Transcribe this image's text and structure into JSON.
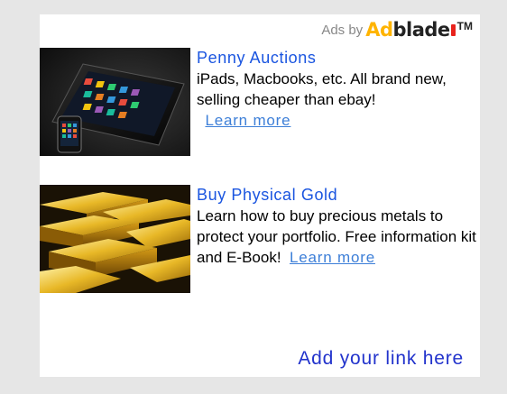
{
  "header": {
    "ads_by": "Ads by",
    "logo_ad": "Ad",
    "logo_blade": "blade",
    "logo_tm": "TM",
    "logo_text": "Adblade"
  },
  "ads": [
    {
      "title": "Penny Auctions",
      "description": "iPads, Macbooks, etc. All brand new, selling cheaper than ebay!",
      "learn_more": "Learn more",
      "image": "tablet-and-phone-image"
    },
    {
      "title": "Buy Physical Gold",
      "description": "Learn how to buy precious metals to protect your portfolio. Free information kit and E-Book!",
      "learn_more": "Learn more",
      "image": "gold-bars-image"
    }
  ],
  "footer": {
    "add_link": "Add your link here"
  },
  "colors": {
    "page_bg": "#e6e6e6",
    "panel_bg": "#ffffff",
    "title": "#1a55e0",
    "learn_more": "#3d7fd8",
    "add_link": "#2233cc",
    "logo_orange": "#ffb400",
    "logo_red": "#e8231d"
  }
}
